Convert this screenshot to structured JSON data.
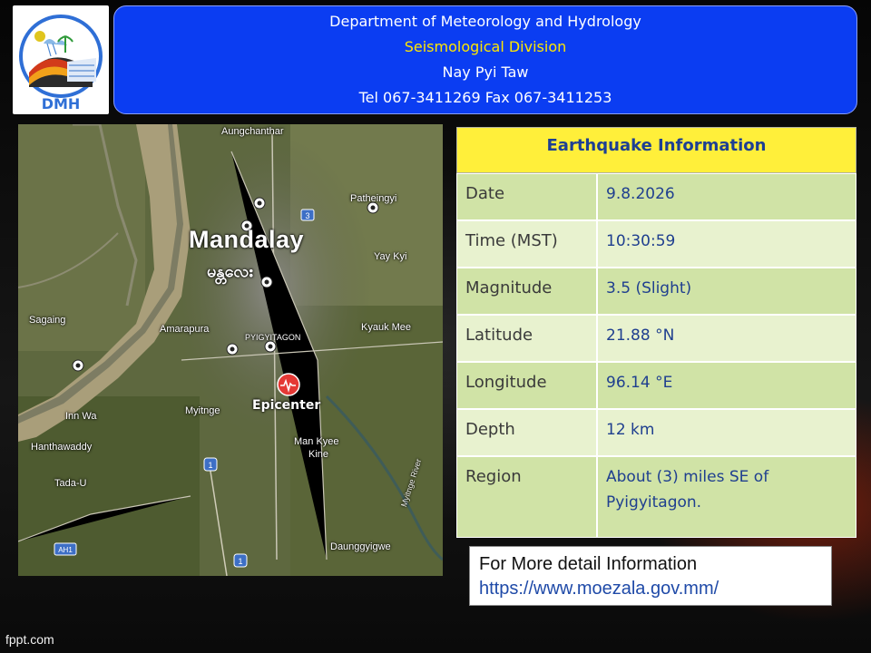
{
  "header": {
    "logo_text": "DMH",
    "line1": "Department of Meteorology and Hydrology",
    "line2": "Seismological Division",
    "line3": "Nay Pyi Taw",
    "line4": "Tel 067-3411269 Fax 067-3411253"
  },
  "map": {
    "labels": {
      "aungchanthar": "Aungchanthar",
      "patheingyi": "Patheingyi",
      "mandalay": "Mandalay",
      "mandalay_burmese": "မန္တလေး",
      "yaykyi": "Yay Kyi",
      "sagaing": "Sagaing",
      "amarapura": "Amarapura",
      "pyigyitagon": "PYIGYITAGON",
      "kyaukmee": "Kyauk Mee",
      "epicenter": "Epicenter",
      "innwa": "Inn Wa",
      "hanthawaddy": "Hanthawaddy",
      "myitnge": "Myitnge",
      "mankyeekine1": "Man Kyee",
      "mankyeekine2": "Kine",
      "tadau": "Tada-U",
      "daunggyigwe": "Daunggyigwe",
      "road3": "3",
      "road1": "1",
      "road1b": "1",
      "ah1": "AH1",
      "river": "Myitnge River"
    },
    "marker_icon": "epicenter-pulse-icon"
  },
  "info": {
    "title": "Earthquake Information",
    "rows": [
      {
        "label": "Date",
        "value": "9.8.2026"
      },
      {
        "label": "Time (MST)",
        "value": "10:30:59"
      },
      {
        "label": "Magnitude",
        "value": "3.5 (Slight)"
      },
      {
        "label": "Latitude",
        "value": "21.88 °N"
      },
      {
        "label": "Longitude",
        "value": "96.14 °E"
      },
      {
        "label": "Depth",
        "value": "12 km"
      },
      {
        "label": "Region",
        "value": "About (3)  miles SE of Pyigyitagon."
      }
    ]
  },
  "detail": {
    "text": "For More detail Information",
    "url": "https://www.moezala.gov.mm/"
  },
  "footer": {
    "brand": "fppt.com"
  },
  "colors": {
    "banner": "#0b3df2",
    "title_bg": "#ffef3a",
    "row_dark": "#d0e3a6",
    "row_light": "#e8f2cf",
    "value_text": "#1f3f8f"
  }
}
